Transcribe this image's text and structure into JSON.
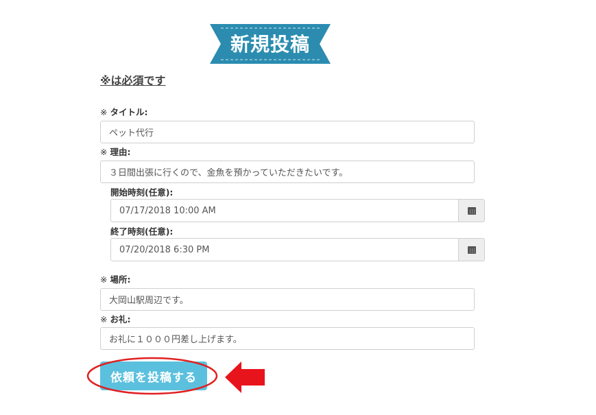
{
  "page": {
    "title": "新規投稿",
    "required_note": "※は必須です"
  },
  "form": {
    "title_field": {
      "mark": "※",
      "label": "タイトル:",
      "value": "ペット代行"
    },
    "reason_field": {
      "mark": "※",
      "label": "理由:",
      "value": "３日間出張に行くので、金魚を預かっていただきたいです。"
    },
    "start_field": {
      "label": "開始時刻(任意):",
      "value": "07/17/2018 10:00 AM",
      "icon": "calendar-icon"
    },
    "end_field": {
      "label": "終了時刻(任意):",
      "value": "07/20/2018 6:30 PM",
      "icon": "calendar-icon"
    },
    "place_field": {
      "mark": "※",
      "label": "場所:",
      "value": "大岡山駅周辺です。"
    },
    "reward_field": {
      "mark": "※",
      "label": "お礼:",
      "value": "お礼に１０００円差し上げます。"
    },
    "submit_label": "依頼を投稿する"
  },
  "colors": {
    "ribbon": "#2b8cb0",
    "button": "#5bc0de",
    "annotation": "#e02020"
  }
}
